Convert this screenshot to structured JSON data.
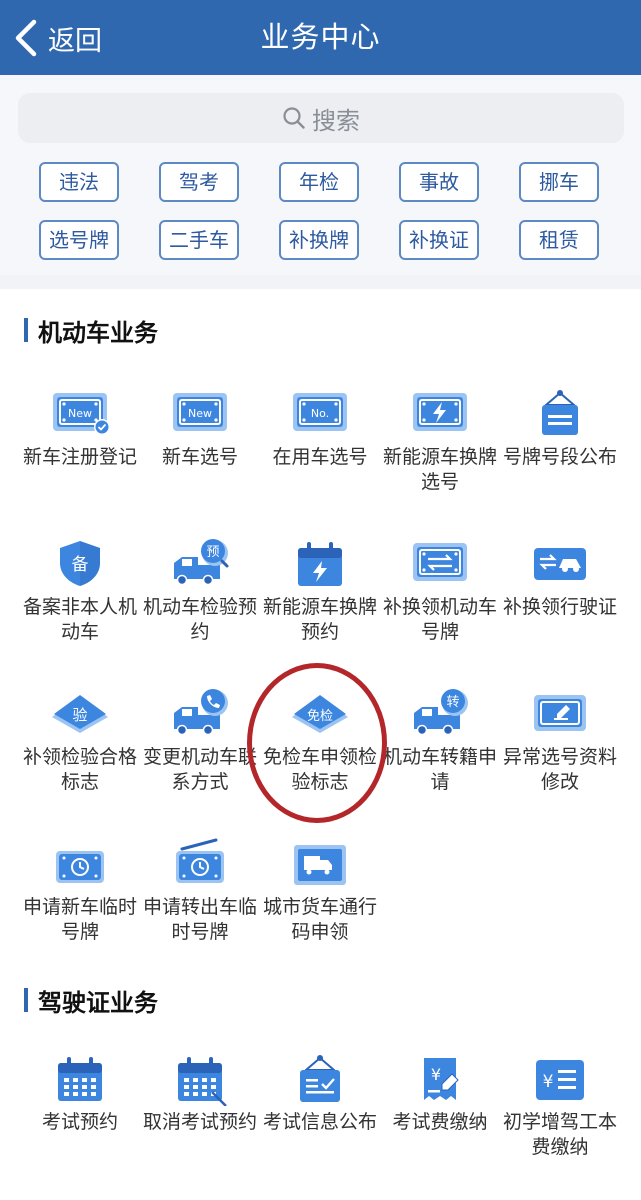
{
  "header": {
    "back_label": "返回",
    "title": "业务中心"
  },
  "search": {
    "placeholder": "搜索"
  },
  "tags": [
    "违法",
    "驾考",
    "年检",
    "事故",
    "挪车",
    "选号牌",
    "二手车",
    "补换牌",
    "补换证",
    "租赁"
  ],
  "sections": [
    {
      "title": "机动车业务",
      "items": [
        {
          "label": "新车注册登记",
          "icon": "new-plate-check-icon"
        },
        {
          "label": "新车选号",
          "icon": "new-plate-icon"
        },
        {
          "label": "在用车选号",
          "icon": "number-plate-icon"
        },
        {
          "label": "新能源车换牌选号",
          "icon": "ev-plate-icon"
        },
        {
          "label": "号牌号段公布",
          "icon": "notice-board-icon"
        },
        {
          "label": "备案非本人机动车",
          "icon": "shield-record-icon"
        },
        {
          "label": "机动车检验预约",
          "icon": "truck-reserve-icon"
        },
        {
          "label": "新能源车换牌预约",
          "icon": "calendar-bolt-icon"
        },
        {
          "label": "补换领机动车号牌",
          "icon": "swap-plate-icon"
        },
        {
          "label": "补换领行驶证",
          "icon": "swap-car-icon"
        },
        {
          "label": "补领检验合格标志",
          "icon": "inspect-diamond-icon"
        },
        {
          "label": "变更机动车联系方式",
          "icon": "truck-phone-icon"
        },
        {
          "label": "免检车申领检验标志",
          "icon": "exempt-diamond-icon"
        },
        {
          "label": "机动车转籍申请",
          "icon": "truck-transfer-icon"
        },
        {
          "label": "异常选号资料修改",
          "icon": "edit-plate-icon"
        },
        {
          "label": "申请新车临时号牌",
          "icon": "temp-plate-clock-icon"
        },
        {
          "label": "申请转出车临时号牌",
          "icon": "temp-plate-radio-icon"
        },
        {
          "label": "城市货车通行码申领",
          "icon": "freight-truck-icon"
        }
      ]
    },
    {
      "title": "驾驶证业务",
      "items": [
        {
          "label": "考试预约",
          "icon": "calendar-grid-icon"
        },
        {
          "label": "取消考试预约",
          "icon": "calendar-cancel-icon"
        },
        {
          "label": "考试信息公布",
          "icon": "exam-notice-icon"
        },
        {
          "label": "考试费缴纳",
          "icon": "fee-receipt-icon"
        },
        {
          "label": "初学增驾工本费缴纳",
          "icon": "fee-list-icon"
        }
      ]
    }
  ],
  "icon_texts": {
    "new": "New",
    "no": "No.",
    "bei": "备",
    "yu": "预",
    "yan": "验",
    "mianjian": "免检",
    "zhuan": "转",
    "yen": "¥"
  },
  "colors": {
    "header": "#3068b0",
    "accent": "#3d86e0",
    "highlight_circle": "#b3262a"
  }
}
